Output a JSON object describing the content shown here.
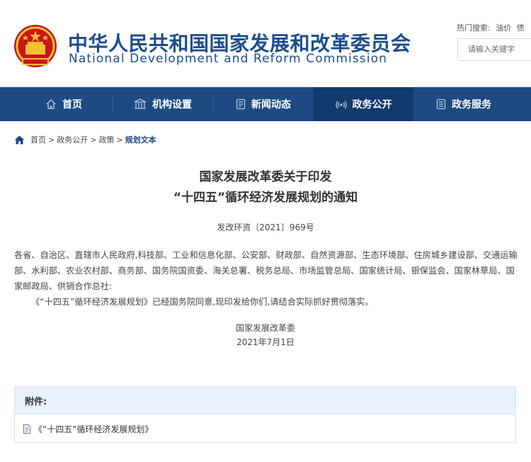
{
  "header": {
    "title_cn": "中华人民共和国国家发展和改革委员会",
    "title_en": "National Development and Reform Commission",
    "hot_label": "热门搜索:",
    "hot_links": [
      "油价",
      "债"
    ],
    "search_placeholder": "请输入关键字"
  },
  "nav": {
    "items": [
      {
        "label": "首页",
        "icon": "home-icon"
      },
      {
        "label": "机构设置",
        "icon": "institution-icon"
      },
      {
        "label": "新闻动态",
        "icon": "news-icon"
      },
      {
        "label": "政务公开",
        "icon": "broadcast-icon",
        "active": true
      },
      {
        "label": "政务服务",
        "icon": "service-icon"
      }
    ],
    "active_color": "#123a6c",
    "bar_color": "#1d4a82"
  },
  "breadcrumb": {
    "items": [
      "首页",
      "政务公开",
      "政策"
    ],
    "separator": ">",
    "current": "规划文本"
  },
  "article": {
    "title_line1": "国家发展改革委关于印发",
    "title_line2": "“十四五”循环经济发展规划的通知",
    "doc_number": "发改环资〔2021〕969号",
    "recipients": "各省、自治区、直辖市人民政府,科技部、工业和信息化部、公安部、财政部、自然资源部、生态环境部、住房城乡建设部、交通运输部、水利部、农业农村部、商务部、国务院国资委、海关总署、税务总局、市场监管总局、国家统计局、银保监会、国家林草局、国家邮政局、供销合作总社:",
    "body": "《“十四五”循环经济发展规划》已经国务院同意,现印发给你们,请结合实际抓好贯彻落实。",
    "signer": "国家发展改革委",
    "date": "2021年7月1日"
  },
  "attachment": {
    "heading": "附件:",
    "file": "《“十四五”循环经济发展规划》"
  }
}
